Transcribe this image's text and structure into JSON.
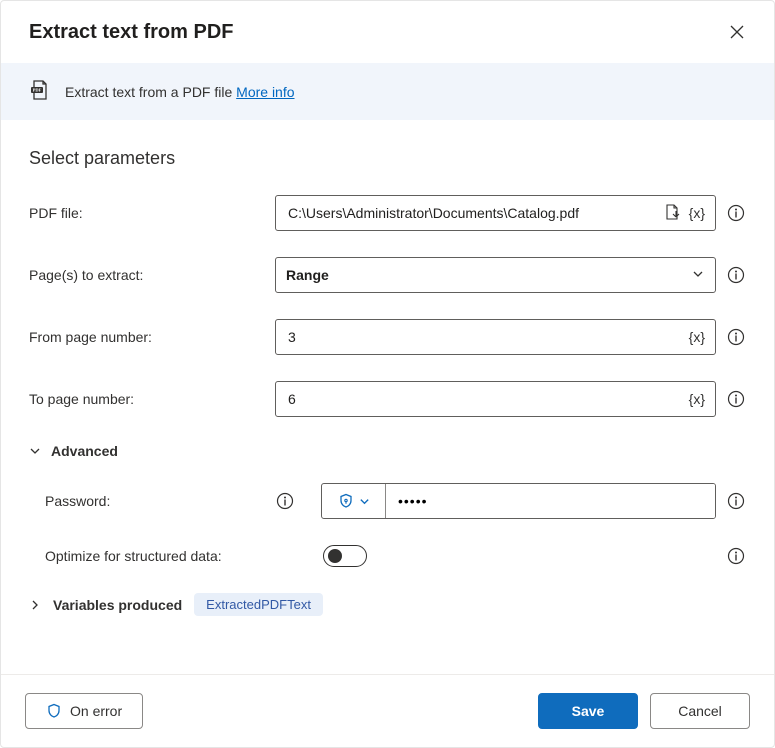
{
  "header": {
    "title": "Extract text from PDF"
  },
  "infoBand": {
    "description": "Extract text from a PDF file",
    "moreInfo": "More info"
  },
  "section": {
    "title": "Select parameters"
  },
  "fields": {
    "pdfFile": {
      "label": "PDF file:",
      "value": "C:\\Users\\Administrator\\Documents\\Catalog.pdf"
    },
    "pagesToExtract": {
      "label": "Page(s) to extract:",
      "value": "Range"
    },
    "fromPage": {
      "label": "From page number:",
      "value": "3"
    },
    "toPage": {
      "label": "To page number:",
      "value": "6"
    }
  },
  "advanced": {
    "label": "Advanced",
    "password": {
      "label": "Password:",
      "value": "•••••"
    },
    "optimize": {
      "label": "Optimize for structured data:"
    }
  },
  "variables": {
    "label": "Variables produced",
    "chip": "ExtractedPDFText"
  },
  "footer": {
    "onError": "On error",
    "save": "Save",
    "cancel": "Cancel"
  },
  "tokens": {
    "varBraces": "{x}"
  }
}
